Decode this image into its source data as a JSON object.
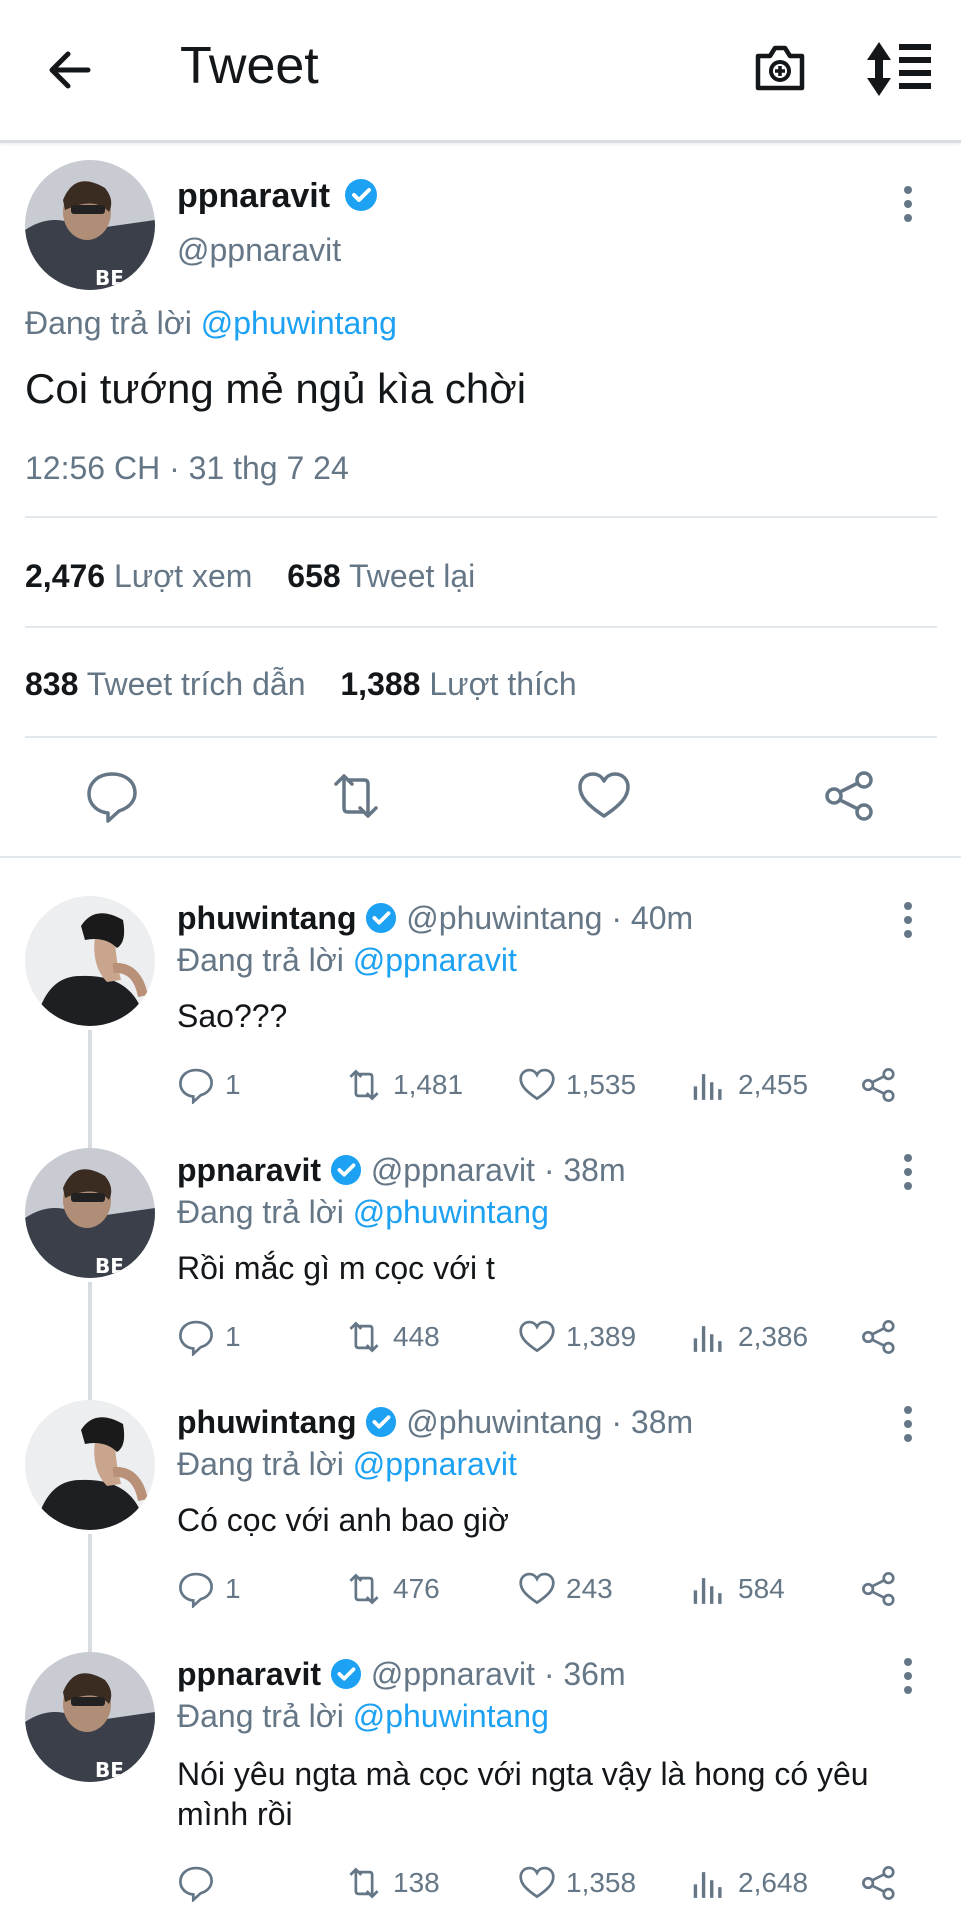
{
  "header": {
    "title": "Tweet",
    "icons": [
      "back-arrow-icon",
      "camera-plus-icon",
      "sort-icon"
    ]
  },
  "main_tweet": {
    "name": "ppnaravit",
    "handle": "@ppnaravit",
    "reply_prefix": "Đang trả lời",
    "reply_to": "@phuwintang",
    "text": "Coi tướng mẻ ngủ kìa chời",
    "timestamp": "12:56 CH · 31 thg 7 24",
    "views_count": "2,476",
    "views_label": "Lượt xem",
    "retweets_count": "658",
    "retweets_label": "Tweet lại",
    "quotes_count": "838",
    "quotes_label": "Tweet trích dẫn",
    "likes_count": "1,388",
    "likes_label": "Lượt thích"
  },
  "replies": [
    {
      "name": "phuwintang",
      "handle": "@phuwintang",
      "time": "· 40m",
      "reply_prefix": "Đang trả lời",
      "reply_to": "@ppnaravit",
      "text": "Sao???",
      "replies": "1",
      "retweets": "1,481",
      "likes": "1,535",
      "views": "2,455"
    },
    {
      "name": "ppnaravit",
      "handle": "@ppnaravit",
      "time": "· 38m",
      "reply_prefix": "Đang trả lời",
      "reply_to": "@phuwintang",
      "text": "Rồi mắc gì m cọc với t",
      "replies": "1",
      "retweets": "448",
      "likes": "1,389",
      "views": "2,386"
    },
    {
      "name": "phuwintang",
      "handle": "@phuwintang",
      "time": "· 38m",
      "reply_prefix": "Đang trả lời",
      "reply_to": "@ppnaravit",
      "text": "Có cọc với anh bao giờ",
      "replies": "1",
      "retweets": "476",
      "likes": "243",
      "views": "584"
    },
    {
      "name": "ppnaravit",
      "handle": "@ppnaravit",
      "time": "· 36m",
      "reply_prefix": "Đang trả lời",
      "reply_to": "@phuwintang",
      "text_line1": "Nói yêu ngta mà cọc với ngta vậy là hong có yêu",
      "text_line2": "mình rồi",
      "retweets": "138",
      "likes": "1,358",
      "views": "2,648"
    }
  ],
  "colors": {
    "accent": "#1da1f2",
    "text": "#14171a",
    "secondary": "#657786",
    "divider": "#e1e8ed"
  }
}
